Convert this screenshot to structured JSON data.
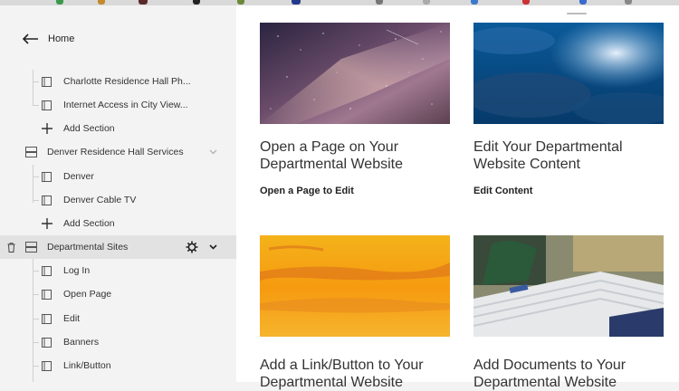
{
  "sidebar": {
    "home_label": "Home",
    "items": [
      {
        "label": "Charlotte Residence Hall Ph...",
        "icon": "page-icon"
      },
      {
        "label": "Internet Access in City View...",
        "icon": "page-icon"
      },
      {
        "label": "Add Section",
        "icon": "plus-icon"
      },
      {
        "label": "Denver Residence Hall Services",
        "icon": "section-icon"
      },
      {
        "label": "Denver",
        "icon": "page-icon"
      },
      {
        "label": "Denver Cable TV",
        "icon": "page-icon"
      },
      {
        "label": "Add Section",
        "icon": "plus-icon"
      },
      {
        "label": "Departmental Sites",
        "icon": "section-icon"
      },
      {
        "label": "Log In",
        "icon": "page-icon"
      },
      {
        "label": "Open Page",
        "icon": "page-icon"
      },
      {
        "label": "Edit",
        "icon": "page-icon"
      },
      {
        "label": "Banners",
        "icon": "page-icon"
      },
      {
        "label": "Link/Button",
        "icon": "page-icon"
      }
    ]
  },
  "cards": [
    {
      "title": "Open a Page on Your Departmental Website",
      "link": "Open a Page to Edit",
      "image": "milky-way-night-sky"
    },
    {
      "title": "Edit Your Departmental Website Content",
      "link": "Edit Content",
      "image": "blue-cloudy-sky"
    },
    {
      "title": "Add a Link/Button to Your Departmental Website",
      "link": "",
      "image": "orange-sunset-sky"
    },
    {
      "title": "Add Documents to Your Departmental Website",
      "link": "",
      "image": "stack-of-documents"
    }
  ],
  "colors": {
    "sidebar_bg": "#f3f3f3",
    "selected_row_bg": "#e2e2e2",
    "main_bg": "#ffffff",
    "text": "#333333"
  }
}
